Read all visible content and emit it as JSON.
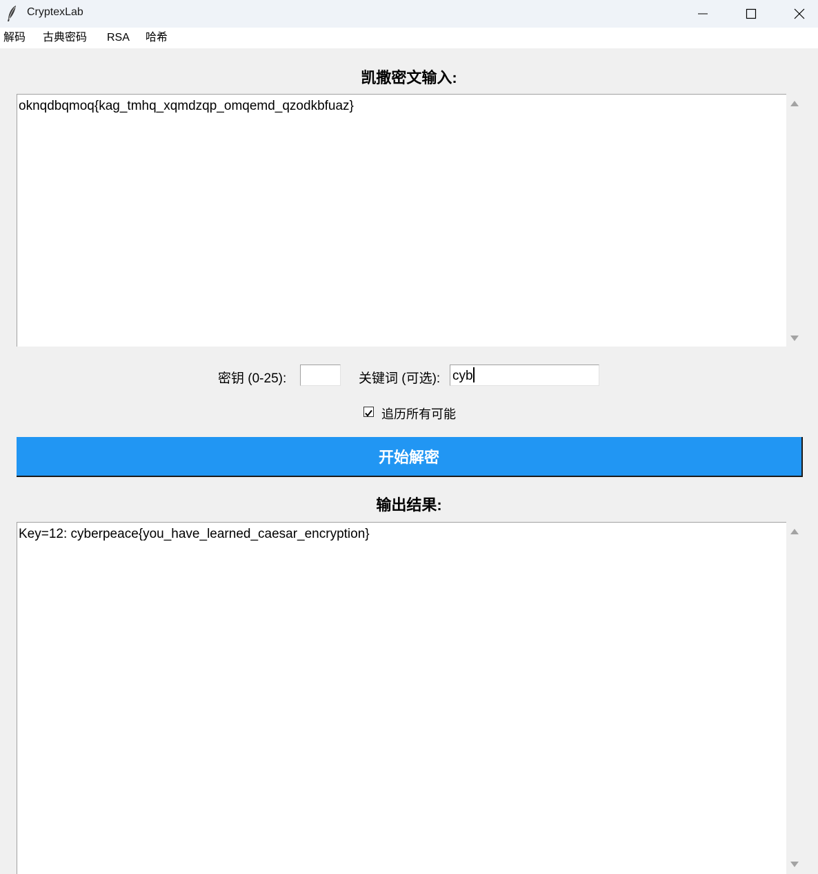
{
  "window": {
    "title": "CryptexLab",
    "icons": {
      "app": "feather-icon",
      "minimize": "minimize-icon",
      "maximize": "maximize-icon",
      "close": "close-icon"
    }
  },
  "menubar": {
    "items": [
      {
        "label": "解码"
      },
      {
        "label": "古典密码"
      },
      {
        "label": "RSA"
      },
      {
        "label": "哈希"
      }
    ]
  },
  "input_section": {
    "heading": "凯撒密文输入:",
    "ciphertext": "oknqdbqmoq{kag_tmhq_xqmdzqp_omqemd_qzodkbfuaz}"
  },
  "options": {
    "key_label": "密钥 (0-25):",
    "key_value": "",
    "keyword_label": "关键词 (可选):",
    "keyword_value": "cyb",
    "bruteforce_label": "追历所有可能",
    "bruteforce_checked": true
  },
  "decrypt_button": {
    "label": "开始解密",
    "color": "#2196f3"
  },
  "output_section": {
    "heading": "输出结果:",
    "result": "Key=12: cyberpeace{you_have_learned_caesar_encryption}"
  }
}
